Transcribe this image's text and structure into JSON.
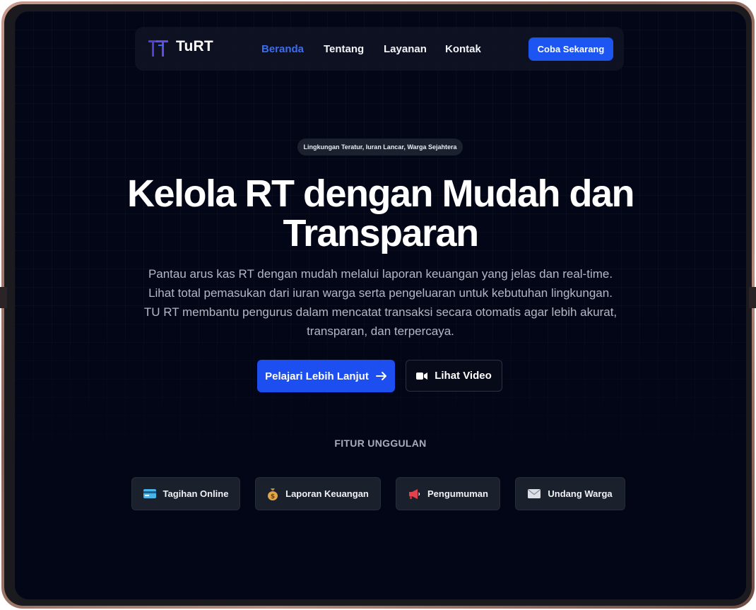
{
  "brand": {
    "name": "TuRT",
    "accent": "#1d4ef0",
    "logo_color": "#4f3fd8"
  },
  "nav": {
    "links": [
      {
        "label": "Beranda",
        "active": true
      },
      {
        "label": "Tentang",
        "active": false
      },
      {
        "label": "Layanan",
        "active": false
      },
      {
        "label": "Kontak",
        "active": false
      }
    ],
    "cta": "Coba Sekarang"
  },
  "hero": {
    "tag": "Lingkungan Teratur, Iuran Lancar, Warga Sejahtera",
    "title_line1": "Kelola RT dengan Mudah dan",
    "title_line2": "Transparan",
    "desc_lines": [
      "Pantau arus kas RT dengan mudah melalui laporan keuangan yang jelas dan real-time.",
      "Lihat total pemasukan dari iuran warga serta pengeluaran untuk kebutuhan lingkungan.",
      "TU RT membantu pengurus dalam mencatat transaksi secara otomatis agar lebih akurat,",
      "transparan, dan terpercaya."
    ],
    "primary_button": {
      "label": "Pelajari Lebih Lanjut",
      "icon": "arrow-right-icon"
    },
    "secondary_button": {
      "label": "Lihat Video",
      "icon": "video-camera-icon"
    }
  },
  "features": {
    "heading": "FITUR UNGGULAN",
    "items": [
      {
        "label": "Tagihan Online",
        "icon": "credit-card-icon"
      },
      {
        "label": "Laporan Keuangan",
        "icon": "money-bag-icon"
      },
      {
        "label": "Pengumuman",
        "icon": "megaphone-icon"
      },
      {
        "label": "Undang Warga",
        "icon": "envelope-icon"
      }
    ]
  }
}
